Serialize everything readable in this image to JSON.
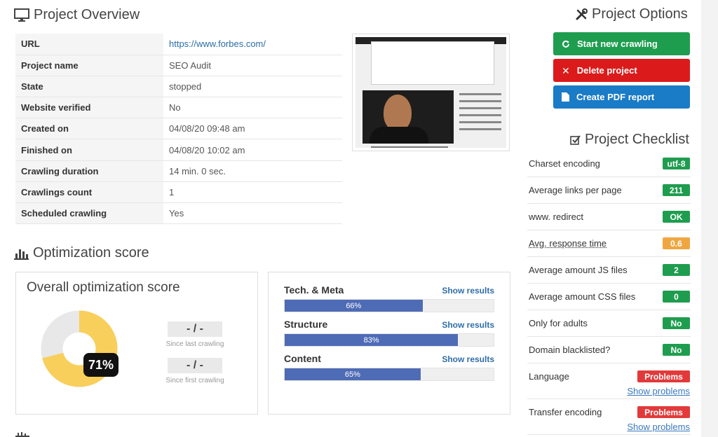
{
  "overview": {
    "title": "Project Overview",
    "rows": [
      {
        "key": "URL",
        "value": "https://www.forbes.com/"
      },
      {
        "key": "Project name",
        "value": "SEO Audit"
      },
      {
        "key": "State",
        "value": "stopped"
      },
      {
        "key": "Website verified",
        "value": "No"
      },
      {
        "key": "Created on",
        "value": "04/08/20 09:48 am"
      },
      {
        "key": "Finished on",
        "value": "04/08/20 10:02 am"
      },
      {
        "key": "Crawling duration",
        "value": "14 min. 0 sec."
      },
      {
        "key": "Crawlings count",
        "value": "1"
      },
      {
        "key": "Scheduled crawling",
        "value": "Yes"
      }
    ]
  },
  "options": {
    "title": "Project Options",
    "start_label": "Start new crawling",
    "delete_label": "Delete project",
    "pdf_label": "Create PDF report"
  },
  "optimization": {
    "title": "Optimization score",
    "overall_title": "Overall optimization score",
    "overall_percent_label": "71%",
    "overall_value": 0.71,
    "since_last_value": "- / -",
    "since_last_label": "Since last crawling",
    "since_first_value": "- / -",
    "since_first_label": "Since first crawling",
    "categories": [
      {
        "name": "Tech. & Meta",
        "link": "Show results",
        "percent_label": "66%",
        "value": 0.66
      },
      {
        "name": "Structure",
        "link": "Show results",
        "percent_label": "83%",
        "value": 0.83
      },
      {
        "name": "Content",
        "link": "Show results",
        "percent_label": "65%",
        "value": 0.65
      }
    ],
    "colors": {
      "gauge_fill": "#f9cf5b",
      "gauge_empty": "#e8e8e8",
      "bar_fill": "#4e6bb5"
    }
  },
  "checklist": {
    "title": "Project Checklist",
    "items": [
      {
        "label": "Charset encoding",
        "badge": "utf-8",
        "status": "ok"
      },
      {
        "label": "Average links per page",
        "badge": "211",
        "status": "ok"
      },
      {
        "label": "www. redirect",
        "badge": "OK",
        "status": "ok"
      },
      {
        "label": "Avg. response time",
        "badge": "0.6",
        "status": "warn"
      },
      {
        "label": "Average amount JS files",
        "badge": "2",
        "status": "ok"
      },
      {
        "label": "Average amount CSS files",
        "badge": "0",
        "status": "ok"
      },
      {
        "label": "Only for adults",
        "badge": "No",
        "status": "ok"
      },
      {
        "label": "Domain blacklisted?",
        "badge": "No",
        "status": "ok"
      },
      {
        "label": "Language",
        "badge": "Problems",
        "status": "bad",
        "link": "Show problems"
      },
      {
        "label": "Transfer encoding",
        "badge": "Problems",
        "status": "bad",
        "link": "Show problems"
      }
    ]
  }
}
